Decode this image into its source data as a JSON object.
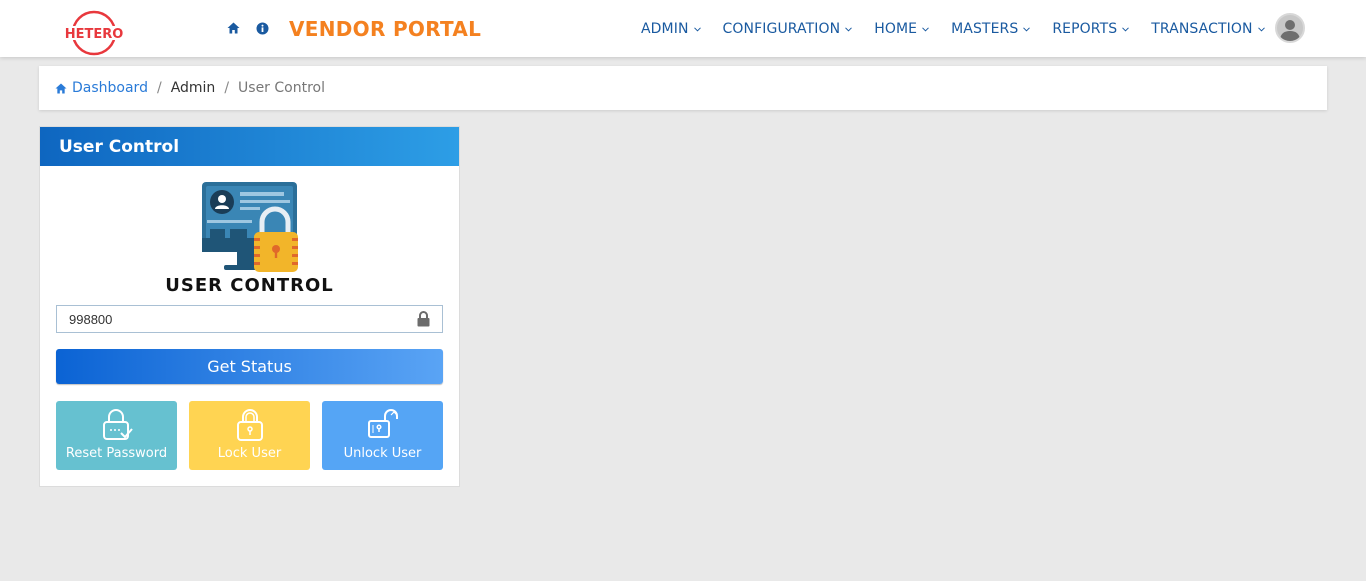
{
  "header": {
    "logo_text": "HETERO",
    "brand": "VENDOR PORTAL",
    "quick_icons": [
      "home-icon",
      "info-icon"
    ],
    "menu": [
      {
        "label": "ADMIN"
      },
      {
        "label": "CONFIGURATION"
      },
      {
        "label": "HOME"
      },
      {
        "label": "MASTERS"
      },
      {
        "label": "REPORTS"
      },
      {
        "label": "TRANSACTION"
      }
    ],
    "colors": {
      "brand": "#f48120",
      "menu": "#1a5aa0",
      "logo": "#e8383d"
    }
  },
  "breadcrumb": {
    "home": "Dashboard",
    "section": "Admin",
    "current": "User Control"
  },
  "card": {
    "header": "User Control",
    "title": "USER CONTROL",
    "input_value": "998800",
    "get_status_label": "Get Status",
    "actions": [
      {
        "label": "Reset Password",
        "icon": "reset-password-icon",
        "color": "#66c1d0"
      },
      {
        "label": "Lock User",
        "icon": "lock-icon",
        "color": "#ffd452"
      },
      {
        "label": "Unlock User",
        "icon": "unlock-icon",
        "color": "#55a5f5"
      }
    ]
  }
}
